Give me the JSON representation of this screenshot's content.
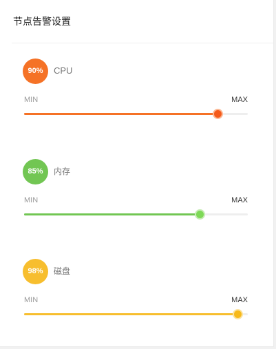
{
  "page": {
    "title": "节点告警设置"
  },
  "metrics": [
    {
      "name": "CPU",
      "badge_text": "90%",
      "value_percent": 86.5,
      "min_label": "MIN",
      "max_label": "MAX",
      "color": "#f57226",
      "thumb_color": "#f55a1a",
      "thumb_glow": "#fbb894"
    },
    {
      "name": "内存",
      "badge_text": "85%",
      "value_percent": 78.5,
      "min_label": "MIN",
      "max_label": "MAX",
      "color": "#72c653",
      "thumb_color": "#7ed957",
      "thumb_glow": "#c6ecb4"
    },
    {
      "name": "磁盘",
      "badge_text": "98%",
      "value_percent": 95.5,
      "min_label": "MIN",
      "max_label": "MAX",
      "color": "#f7be2e",
      "thumb_color": "#f7b91a",
      "thumb_glow": "#fbe2a0"
    }
  ]
}
